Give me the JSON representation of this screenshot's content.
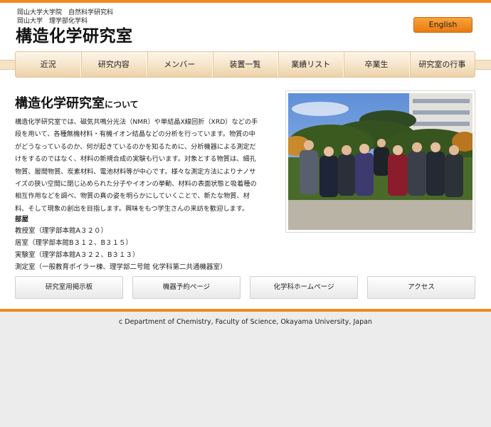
{
  "header": {
    "university_line1": "岡山大学大学院　自然科学研究科",
    "university_line2": "岡山大学　理学部化学科",
    "lab_title": "構造化学研究室",
    "english_button": "English"
  },
  "nav": {
    "items": [
      "近況",
      "研究内容",
      "メンバー",
      "装置一覧",
      "業績リスト",
      "卒業生",
      "研究室の行事"
    ]
  },
  "about": {
    "title_main": "構造化学研究室",
    "title_suffix": "について",
    "lines": [
      "構造化学研究室では、磁気共鳴分光法（NMR）や単結晶X線回折（XRD）などの手",
      "段を用いて、各種無機材料・有機イオン結晶などの分析を行っています。物質の中",
      "がどうなっているのか、何が起きているのかを知るために、分析機器による測定だ",
      "けをするのではなく、材料の新規合成の実験も行います。対象とする物質は、細孔",
      "物質、層間物質、炭素材料、電池材料等が中心です。様々な測定方法によりナノサ",
      "イズの狭い空間に閉じ込められた分子やイオンの挙動、材料の表面状態と吸着種の",
      "相互作用などを調べ、物質の真の姿を明らかにしていくことで、新たな物質、材",
      "料、そして現象の創出を目指します。興味をもつ学生さんの来訪を歓迎します。"
    ]
  },
  "rooms": {
    "heading": "部屋",
    "items": [
      "教授室（理学部本館A３２０）",
      "居室（理学部本館B３１２、B３１５）",
      "実験室（理学部本館A３２２、B３１３）",
      "測定室（一般教育ボイラー棟、理学部二号館 化学科第二共通機器室）"
    ]
  },
  "buttons": {
    "board": "研究室用掲示板",
    "reservation": "機器予約ページ",
    "dept_home": "化学科ホームページ",
    "access": "アクセス"
  },
  "footer": {
    "copyright": "c Department of Chemistry, Faculty of Science, Okayama University, Japan"
  },
  "colors": {
    "accent": "#f08a1c",
    "nav_bg": "#f6e4c8"
  }
}
